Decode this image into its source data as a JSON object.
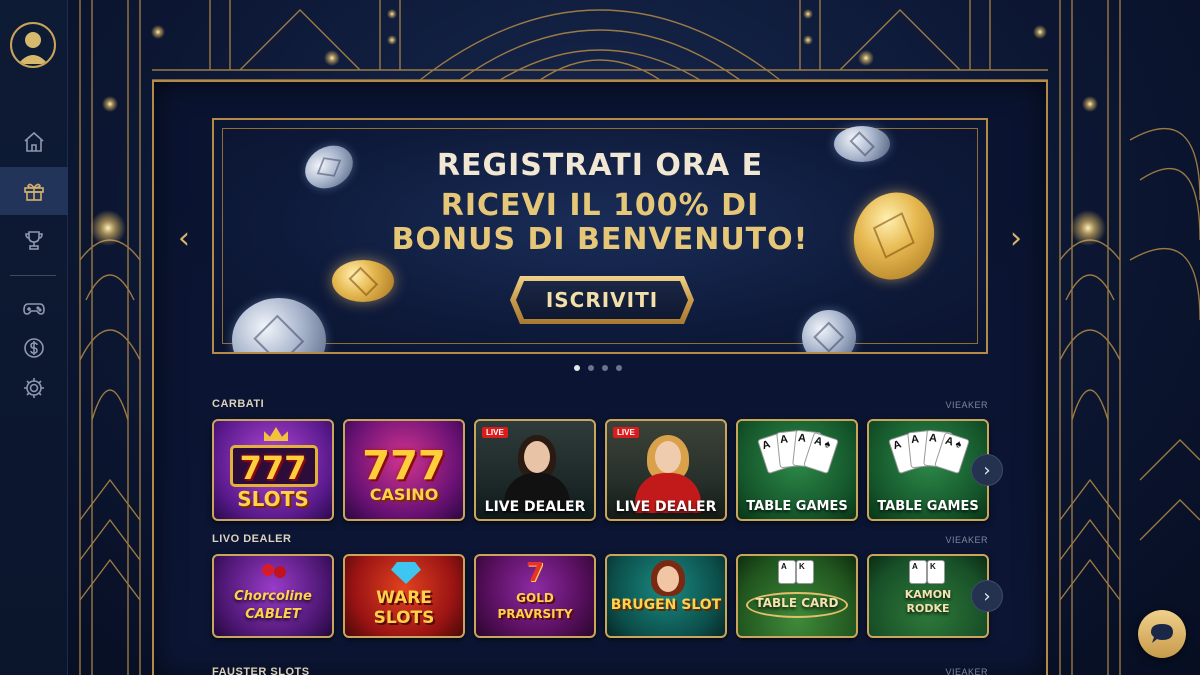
{
  "sidebar": {
    "items": [
      {
        "icon": "home-icon"
      },
      {
        "icon": "gift-icon",
        "active": true
      },
      {
        "icon": "trophy-icon"
      },
      {
        "icon": "gamepad-icon"
      },
      {
        "icon": "dollar-icon"
      },
      {
        "icon": "gear-icon"
      }
    ]
  },
  "banner": {
    "line1": "REGISTRATI ORA E",
    "line2": "RICEVI IL 100% DI",
    "line3": "BONUS DI BENVENUTO!",
    "cta": "ISCRIVITI",
    "prev": "‹",
    "next": "›",
    "slides": 4,
    "active_slide": 1
  },
  "sections": [
    {
      "title": "CARBATI",
      "view_all": "VIEAKER",
      "tiles": [
        {
          "big": "777",
          "label": "SLOTS",
          "theme": "purple"
        },
        {
          "big": "777",
          "label": "CASINO",
          "theme": "magenta"
        },
        {
          "label": "LIVE DEALER",
          "badge": "LIVE",
          "theme": "live1"
        },
        {
          "label": "LIVE DEALER",
          "badge": "LIVE",
          "theme": "live2"
        },
        {
          "label": "TABLE GAMES",
          "theme": "green"
        },
        {
          "label": "TABLE GAMES",
          "theme": "green"
        }
      ]
    },
    {
      "title": "LIVO DEALER",
      "view_all": "VIEAKER",
      "tiles": [
        {
          "label": "Chorcoline CABLET",
          "theme": "violet"
        },
        {
          "label": "WARE SLOTS",
          "theme": "red"
        },
        {
          "label": "GOLD PRAVRSITY",
          "big": "7",
          "theme": "red2"
        },
        {
          "label": "BRUGEN SLOT",
          "theme": "teal"
        },
        {
          "label": "TABLE CARD",
          "theme": "felt"
        },
        {
          "label": "KAMON RODKE",
          "theme": "felt2"
        }
      ]
    },
    {
      "title": "FAUSTER SLOTS",
      "view_all": "VIEAKER"
    }
  ],
  "colors": {
    "gold": "#b48b46",
    "navy": "#0b1630",
    "accent_text": "#e6c778"
  }
}
